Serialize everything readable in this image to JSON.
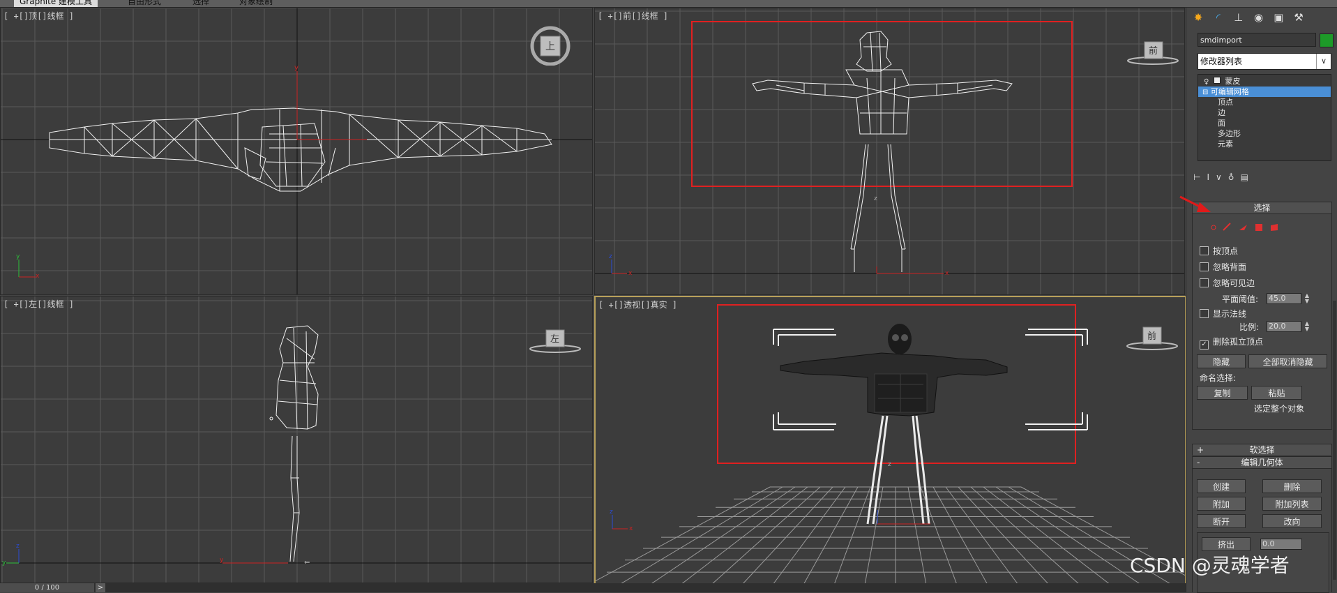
{
  "ribbon": {
    "tabs": [
      "Graphite 建模工具",
      "自由形式",
      "选择",
      "对象绘制"
    ]
  },
  "viewports": {
    "top": {
      "label": "[ +[]顶[]线框 ]",
      "cube": "上"
    },
    "front": {
      "label": "[ +[]前[]线框 ]",
      "cube": "前"
    },
    "left": {
      "label": "[ +[]左[]线框 ]",
      "cube": "左"
    },
    "perspective": {
      "label": "[ +[]透视[]真实 ]",
      "cube": "前"
    }
  },
  "axes": {
    "x": "x",
    "y": "y",
    "z": "z"
  },
  "status": {
    "frame": "0 / 100",
    "arrow": ">"
  },
  "command_panel": {
    "tab_icons": [
      "create-icon",
      "modify-icon",
      "hierarchy-icon",
      "motion-icon",
      "display-icon",
      "utilities-icon"
    ],
    "object_name": "smdimport",
    "object_color": "#1d9a28",
    "modifier_list": "修改器列表",
    "stack": [
      {
        "label": "蒙皮",
        "level": 0
      },
      {
        "label": "可编辑网格",
        "level": 0,
        "selected": true
      },
      {
        "label": "顶点",
        "level": 1
      },
      {
        "label": "边",
        "level": 1
      },
      {
        "label": "面",
        "level": 1
      },
      {
        "label": "多边形",
        "level": 1
      },
      {
        "label": "元素",
        "level": 1
      }
    ],
    "selection": {
      "title": "选择",
      "by_vertex": "按顶点",
      "ignore_backfacing": "忽略背面",
      "ignore_visible_edges": "忽略可见边",
      "planar_threshold_label": "平面阈值:",
      "planar_threshold": "45.0",
      "show_normals": "显示法线",
      "scale_label": "比例:",
      "scale": "20.0",
      "delete_isolated": "删除孤立顶点",
      "hide": "隐藏",
      "unhide_all": "全部取消隐藏",
      "named_selections": "命名选择:",
      "copy": "复制",
      "paste": "粘贴",
      "select_whole": "选定整个对象"
    },
    "soft_selection": {
      "title": "软选择",
      "toggle": "+"
    },
    "edit_geometry": {
      "title": "编辑几何体",
      "toggle": "-",
      "create": "创建",
      "delete": "删除",
      "attach": "附加",
      "attach_list": "附加列表",
      "detach": "断开",
      "turn": "改向",
      "extrude": "挤出",
      "extrude_value": "0.0"
    }
  },
  "watermark": "CSDN @灵魂学者"
}
